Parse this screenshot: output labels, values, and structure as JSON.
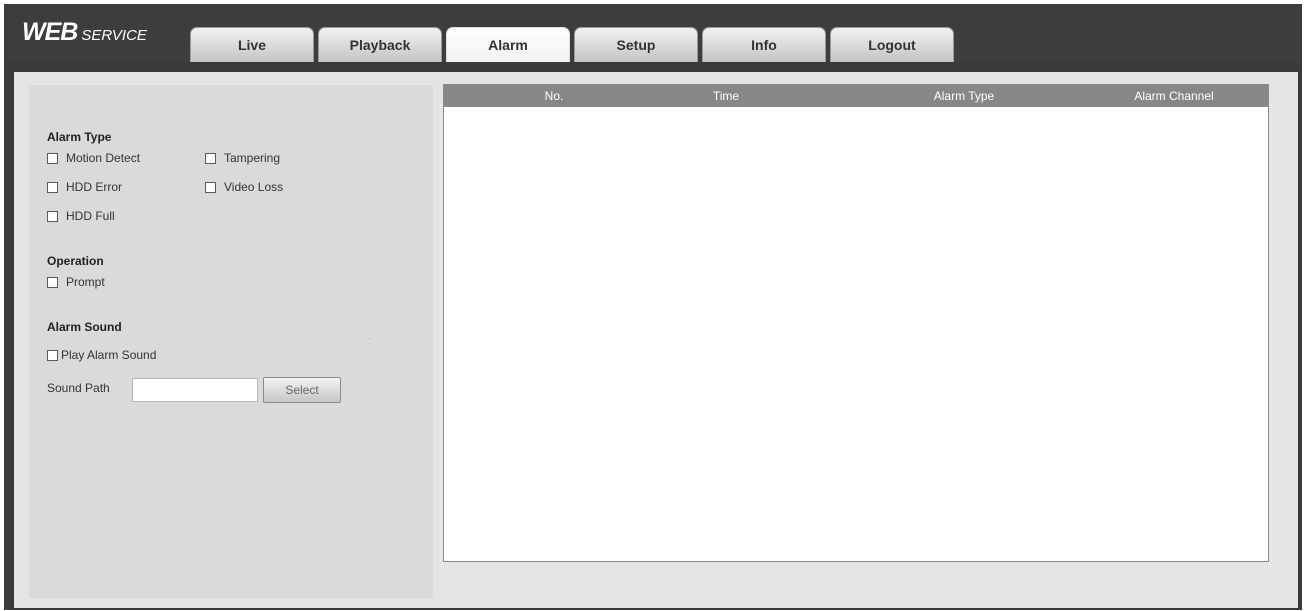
{
  "brand": {
    "logo_bold": "WEB",
    "logo_light": "SERVICE"
  },
  "tabs": [
    {
      "label": "Live",
      "active": false
    },
    {
      "label": "Playback",
      "active": false
    },
    {
      "label": "Alarm",
      "active": true
    },
    {
      "label": "Setup",
      "active": false
    },
    {
      "label": "Info",
      "active": false
    },
    {
      "label": "Logout",
      "active": false
    }
  ],
  "alarm_type": {
    "title": "Alarm Type",
    "options": [
      {
        "label": "Motion Detect",
        "checked": false
      },
      {
        "label": "Tampering",
        "checked": false
      },
      {
        "label": "HDD Error",
        "checked": false
      },
      {
        "label": "Video Loss",
        "checked": false
      },
      {
        "label": "HDD Full",
        "checked": false
      }
    ]
  },
  "operation": {
    "title": "Operation",
    "prompt_label": "Prompt",
    "prompt_checked": false
  },
  "alarm_sound": {
    "title": "Alarm Sound",
    "play_label": "Play Alarm Sound",
    "play_checked": false,
    "path_label": "Sound Path",
    "path_value": "",
    "select_label": "Select"
  },
  "table": {
    "columns": [
      "No.",
      "Time",
      "Alarm Type",
      "Alarm Channel"
    ],
    "rows": []
  },
  "colors": {
    "topbar": "#3d3d3d",
    "panel": "#e4e4e4",
    "table_header": "#878787"
  }
}
